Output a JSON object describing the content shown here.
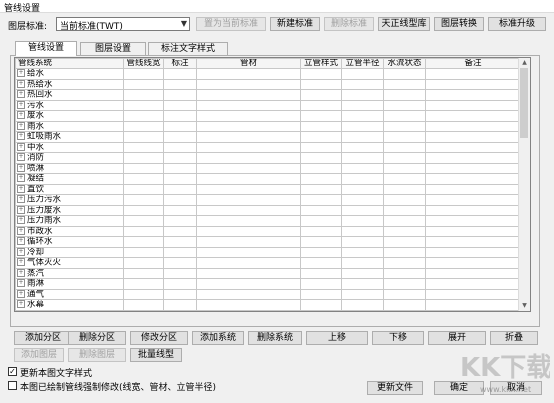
{
  "window": {
    "title": "管线设置"
  },
  "toolbar": {
    "standard_label": "图层标准:",
    "standard_value": "当前标准(TWT)",
    "set_current": "置为当前标准",
    "new_standard": "新建标准",
    "delete_standard": "删除标准",
    "tangent_lib": "天正线型库",
    "layer_convert": "图层转换",
    "standard_upgrade": "标准升级"
  },
  "tabs": [
    "管线设置",
    "图层设置",
    "标注文字样式"
  ],
  "table": {
    "columns": [
      "管线系统",
      "管线线宽",
      "标注",
      "管材",
      "立管样式",
      "立管半径",
      "水流状态",
      "备注"
    ],
    "rows": [
      "给水",
      "热给水",
      "热回水",
      "污水",
      "废水",
      "雨水",
      "虹吸雨水",
      "中水",
      "消防",
      "喷淋",
      "凝结",
      "直饮",
      "压力污水",
      "压力废水",
      "压力雨水",
      "市政水",
      "循环水",
      "冷却",
      "气体灭火",
      "蒸汽",
      "雨淋",
      "通气",
      "水幕"
    ]
  },
  "actions": {
    "row1": [
      "添加分区",
      "删除分区",
      "修改分区",
      "添加系统",
      "删除系统",
      "上移",
      "下移",
      "展开",
      "折叠"
    ],
    "row2": [
      "添加图层",
      "删除图层",
      "批量线型"
    ]
  },
  "options": {
    "update_text_style": "更新本图文字样式",
    "force_modify": "本图已绘制管线强制修改(线宽、管材、立管半径)"
  },
  "footer": {
    "update_file": "更新文件",
    "ok": "确定",
    "cancel": "取消"
  },
  "watermark": {
    "logo": "KK下载",
    "url": "www.kkx.net"
  }
}
